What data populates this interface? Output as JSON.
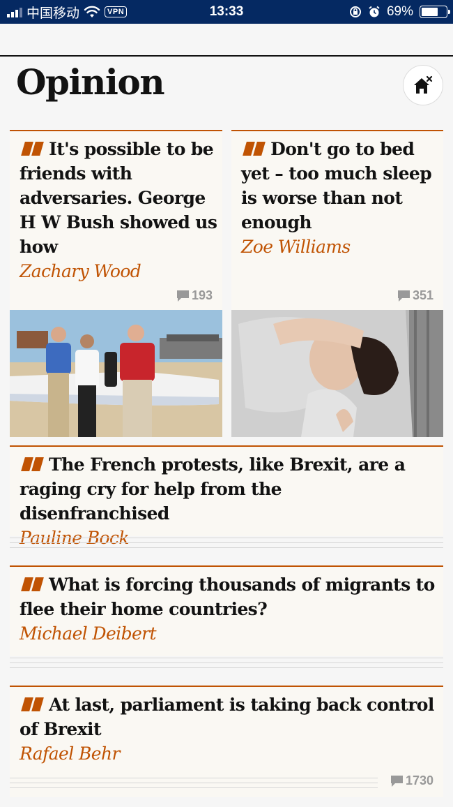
{
  "status_bar": {
    "carrier": "中国移动",
    "vpn": "VPN",
    "time": "13:33",
    "battery": "69%",
    "battery_level": 0.69
  },
  "page": {
    "title": "Opinion"
  },
  "articles": [
    {
      "headline": "It's possible to be friends with adversaries. George H W Bush showed us how",
      "author": "Zachary Wood",
      "comments": "193",
      "image": "politicians-walking-beach"
    },
    {
      "headline": "Don't go to bed yet – too much sleep is worse than not enough",
      "author": "Zoe Williams",
      "comments": "351",
      "image": "woman-sleeping-bed"
    },
    {
      "headline": "The French protests, like Brexit, are a raging cry for help from the disenfranchised",
      "author": "Pauline Bock"
    },
    {
      "headline": "What is forcing thousands of migrants to flee their home countries?",
      "author": "Michael Deibert"
    },
    {
      "headline": "At last, parliament is taking back control of Brexit",
      "author": "Rafael Behr",
      "comments": "1730"
    }
  ],
  "colors": {
    "accent": "#c05303",
    "header_bg": "#052962",
    "card_bg": "#faf8f3"
  }
}
